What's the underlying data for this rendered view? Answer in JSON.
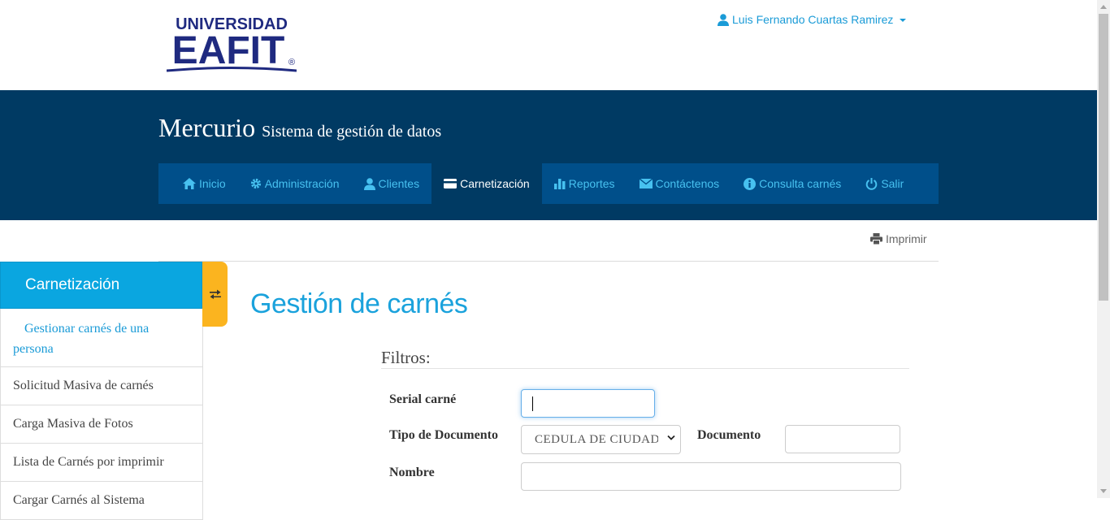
{
  "brand": {
    "line1": "UNIVERSIDAD",
    "line2": "EAFIT",
    "registered": "®",
    "color": "#1f2a80"
  },
  "user": {
    "name": "Luis Fernando Cuartas Ramirez"
  },
  "app": {
    "title": "Mercurio",
    "subtitle": "Sistema de gestión de datos"
  },
  "nav": [
    {
      "label": "Inicio",
      "icon": "home-icon"
    },
    {
      "label": "Administración",
      "icon": "gear-icon"
    },
    {
      "label": "Clientes",
      "icon": "user-icon"
    },
    {
      "label": "Carnetización",
      "icon": "card-icon",
      "active": true
    },
    {
      "label": "Reportes",
      "icon": "bar-chart-icon"
    },
    {
      "label": "Contáctenos",
      "icon": "envelope-icon"
    },
    {
      "label": "Consulta carnés",
      "icon": "info-icon"
    },
    {
      "label": "Salir",
      "icon": "power-icon"
    }
  ],
  "print_label": "Imprimir",
  "sidebar": {
    "title": "Carnetización",
    "items": [
      {
        "label": "Gestionar carnés de una persona",
        "current": true
      },
      {
        "label": "Solicitud Masiva de carnés"
      },
      {
        "label": "Carga Masiva de Fotos"
      },
      {
        "label": "Lista de Carnés por imprimir"
      },
      {
        "label": "Cargar Carnés al Sistema"
      }
    ]
  },
  "main": {
    "title": "Gestión de carnés",
    "filters_title": "Filtros:",
    "fields": {
      "serial": {
        "label": "Serial carné",
        "value": ""
      },
      "doc_type": {
        "label": "Tipo de Documento",
        "value": "CEDULA DE CIUDADANIA"
      },
      "document": {
        "label": "Documento",
        "value": ""
      },
      "name": {
        "label": "Nombre",
        "value": ""
      }
    }
  },
  "colors": {
    "banner": "#003a63",
    "nav": "#004f8a",
    "accent": "#1aa2dc",
    "tab": "#fbb41f"
  }
}
